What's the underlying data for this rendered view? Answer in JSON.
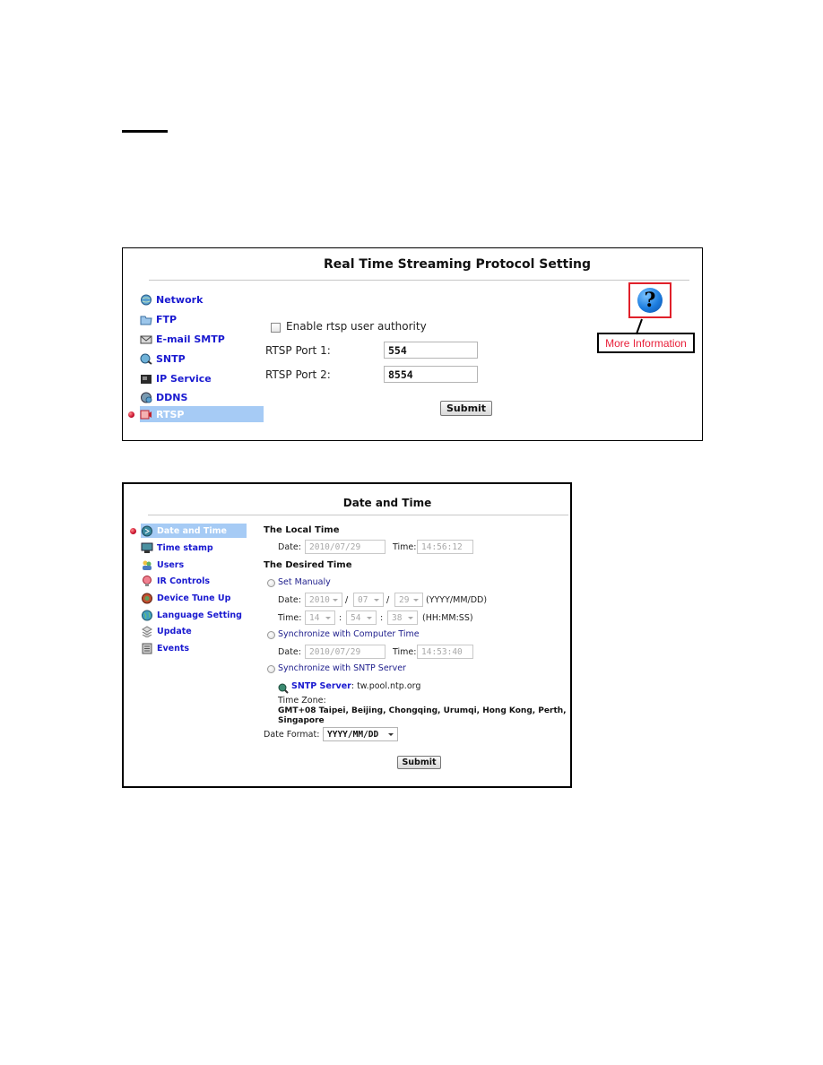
{
  "rtsp_panel": {
    "title": "Real Time Streaming Protocol Setting",
    "sidebar": [
      {
        "label": "Network",
        "icon": "network-globe-icon",
        "active": false
      },
      {
        "label": "FTP",
        "icon": "ftp-folder-icon",
        "active": false
      },
      {
        "label": "E-mail SMTP",
        "icon": "email-icon",
        "active": false
      },
      {
        "label": "SNTP",
        "icon": "sntp-clock-icon",
        "active": false
      },
      {
        "label": "IP Service",
        "icon": "ip-service-icon",
        "active": false
      },
      {
        "label": "DDNS",
        "icon": "ddns-globe-icon",
        "active": false
      },
      {
        "label": "RTSP",
        "icon": "rtsp-camera-icon",
        "active": true
      }
    ],
    "enable_auth_label": "Enable rtsp user authority",
    "enable_auth_checked": false,
    "port1_label": "RTSP Port 1:",
    "port1_value": "554",
    "port2_label": "RTSP Port 2:",
    "port2_value": "8554",
    "submit_label": "Submit",
    "help_glyph": "?",
    "help_label": "More Information"
  },
  "datetime_panel": {
    "title": "Date and Time",
    "sidebar": [
      {
        "label": "Date and Time",
        "icon": "clock-icon",
        "active": true
      },
      {
        "label": "Time stamp",
        "icon": "timestamp-icon",
        "active": false
      },
      {
        "label": "Users",
        "icon": "users-icon",
        "active": false
      },
      {
        "label": "IR Controls",
        "icon": "ir-bulb-icon",
        "active": false
      },
      {
        "label": "Device Tune Up",
        "icon": "tune-up-icon",
        "active": false
      },
      {
        "label": "Language Setting",
        "icon": "language-globe-icon",
        "active": false
      },
      {
        "label": "Update",
        "icon": "update-icon",
        "active": false
      },
      {
        "label": "Events",
        "icon": "events-icon",
        "active": false
      }
    ],
    "local_time_heading": "The Local Time",
    "local_date_label": "Date:",
    "local_date_value": "2010/07/29",
    "local_time_label": "Time:",
    "local_time_value": "14:56:12",
    "desired_time_heading": "The Desired Time",
    "set_manually_label": "Set Manualy",
    "manual_date_label": "Date:",
    "manual_year": "2010",
    "manual_month": "07",
    "manual_day": "29",
    "date_sep": "/",
    "date_format_hint": "(YYYY/MM/DD)",
    "manual_time_label": "Time:",
    "manual_hour": "14",
    "manual_minute": "54",
    "manual_second": "38",
    "time_sep": ":",
    "time_format_hint": "(HH:MM:SS)",
    "sync_computer_label": "Synchronize with Computer Time",
    "computer_date_label": "Date:",
    "computer_date_value": "2010/07/29",
    "computer_time_label": "Time:",
    "computer_time_value": "14:53:40",
    "sync_sntp_label": "Synchronize with SNTP Server",
    "sntp_server_label": "SNTP Server",
    "sntp_server_value": ": tw.pool.ntp.org",
    "time_zone_label": "Time Zone:",
    "time_zone_value_line1": "GMT+08 Taipei, Beijing, Chongqing, Urumqi, Hong Kong, Perth,",
    "time_zone_value_line2": "Singapore",
    "date_format_label": "Date Format:",
    "date_format_value": "YYYY/MM/DD",
    "submit_label": "Submit"
  },
  "colors": {
    "link_blue": "#1a1ad0",
    "active_bg": "#a6cbf5",
    "callout_red": "#e0202a",
    "help_text_red": "#e8203a"
  }
}
